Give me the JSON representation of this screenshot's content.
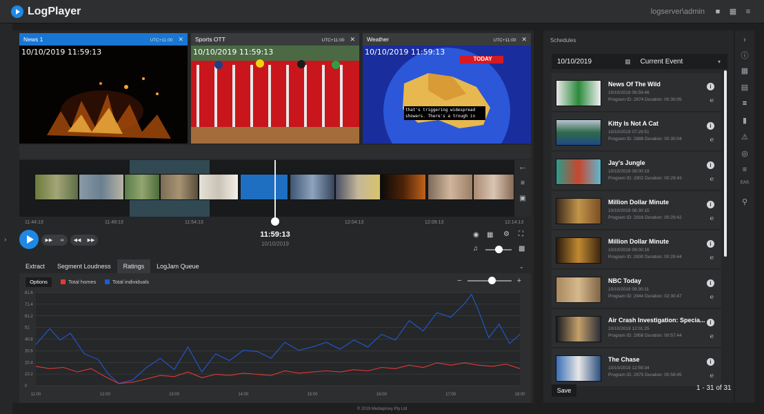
{
  "app": {
    "name": "LogPlayer",
    "user": "logserver\\admin"
  },
  "videos": [
    {
      "name": "News 1",
      "tz": "UTC+11:00",
      "timestamp": "10/10/2019 11:59:13"
    },
    {
      "name": "Sports OTT",
      "tz": "UTC+11:00",
      "timestamp": "10/10/2019 11:59:13"
    },
    {
      "name": "Weather",
      "tz": "UTC+11:00",
      "timestamp": "10/10/2019 11:59:13",
      "badge": "TODAY",
      "caption": "that's triggering widespread showers. There's a trough in"
    }
  ],
  "zoom": {
    "minus": "−",
    "plus": "+"
  },
  "timeline": {
    "ticks": [
      "11:44:13",
      "11:49:13",
      "11:54:13",
      "12:04:13",
      "12:09:13",
      "12:14:13"
    ],
    "current_time": "11:59:13",
    "current_date": "10/10/2019"
  },
  "tabs": [
    {
      "label": "Extract"
    },
    {
      "label": "Segment Loudness"
    },
    {
      "label": "Ratings"
    },
    {
      "label": "LogJam Queue"
    }
  ],
  "ratings": {
    "options_label": "Options",
    "legend": [
      {
        "name": "Total homes",
        "color": "#e53935"
      },
      {
        "name": "Total individuals",
        "color": "#1e5bd6"
      }
    ]
  },
  "chart_data": {
    "type": "line",
    "x_ticks": [
      "11:00",
      "12:00",
      "13:00",
      "14:00",
      "15:00",
      "16:00",
      "17:00",
      "18:00"
    ],
    "y_ticks": [
      "81.6",
      "71.4",
      "61.2",
      "51",
      "40.8",
      "30.6",
      "20.4",
      "10.2",
      "0"
    ],
    "ylim": [
      0,
      81.6
    ],
    "xlim": [
      0,
      7
    ],
    "series": [
      {
        "name": "Total individuals",
        "color": "#1e5bd6",
        "values": [
          [
            0,
            36
          ],
          [
            0.2,
            50
          ],
          [
            0.35,
            40
          ],
          [
            0.5,
            46
          ],
          [
            0.7,
            28
          ],
          [
            0.9,
            23
          ],
          [
            1.05,
            10
          ],
          [
            1.2,
            2
          ],
          [
            1.4,
            5
          ],
          [
            1.6,
            16
          ],
          [
            1.8,
            24
          ],
          [
            2.0,
            14
          ],
          [
            2.2,
            34
          ],
          [
            2.4,
            12
          ],
          [
            2.6,
            28
          ],
          [
            2.8,
            22
          ],
          [
            3.0,
            31
          ],
          [
            3.2,
            30
          ],
          [
            3.4,
            24
          ],
          [
            3.6,
            38
          ],
          [
            3.8,
            31
          ],
          [
            4.0,
            34
          ],
          [
            4.2,
            38
          ],
          [
            4.4,
            32
          ],
          [
            4.6,
            40
          ],
          [
            4.8,
            34
          ],
          [
            5.0,
            45
          ],
          [
            5.2,
            40
          ],
          [
            5.4,
            57
          ],
          [
            5.6,
            48
          ],
          [
            5.8,
            64
          ],
          [
            6.0,
            60
          ],
          [
            6.2,
            72
          ],
          [
            6.3,
            80
          ],
          [
            6.4,
            66
          ],
          [
            6.55,
            42
          ],
          [
            6.7,
            54
          ],
          [
            6.85,
            37
          ],
          [
            7.0,
            45
          ]
        ]
      },
      {
        "name": "Total homes",
        "color": "#e53935",
        "values": [
          [
            0,
            17
          ],
          [
            0.2,
            15
          ],
          [
            0.4,
            16
          ],
          [
            0.6,
            12
          ],
          [
            0.8,
            15
          ],
          [
            1.0,
            8
          ],
          [
            1.2,
            2
          ],
          [
            1.4,
            3
          ],
          [
            1.6,
            6
          ],
          [
            1.8,
            9
          ],
          [
            2.0,
            8
          ],
          [
            2.2,
            12
          ],
          [
            2.4,
            7
          ],
          [
            2.6,
            10
          ],
          [
            2.8,
            9
          ],
          [
            3.0,
            11
          ],
          [
            3.2,
            10
          ],
          [
            3.4,
            9
          ],
          [
            3.6,
            13
          ],
          [
            3.8,
            11
          ],
          [
            4.0,
            12
          ],
          [
            4.2,
            13
          ],
          [
            4.4,
            12
          ],
          [
            4.6,
            14
          ],
          [
            4.8,
            13
          ],
          [
            5.0,
            16
          ],
          [
            5.2,
            15
          ],
          [
            5.4,
            18
          ],
          [
            5.6,
            16
          ],
          [
            5.8,
            20
          ],
          [
            6.0,
            18
          ],
          [
            6.2,
            20
          ],
          [
            6.4,
            18
          ],
          [
            6.6,
            17
          ],
          [
            6.8,
            19
          ],
          [
            7.0,
            15
          ]
        ]
      }
    ]
  },
  "schedules": {
    "title": "Schedules",
    "date": "10/10/2019",
    "mode": "Current Event",
    "items": [
      {
        "title": "News Of The Wild",
        "time": "10/10/2019 06:59:46",
        "meta": "Program ID: 2874   Duration: 00:30:05"
      },
      {
        "title": "Kitty Is Not A Cat",
        "time": "10/10/2019 07:29:51",
        "meta": "Program ID: 2888   Duration: 00:30:04"
      },
      {
        "title": "Jay's Jungle",
        "time": "10/10/2019 08:00:19",
        "meta": "Program ID: 2902   Duration: 00:29:43"
      },
      {
        "title": "Million Dollar Minute",
        "time": "10/10/2019 08:30:15",
        "meta": "Program ID: 2916   Duration: 00:29:42"
      },
      {
        "title": "Million Dollar Minute",
        "time": "10/10/2019 09:00:16",
        "meta": "Program ID: 2930   Duration: 00:29:44"
      },
      {
        "title": "NBC Today",
        "time": "10/10/2019 09:30:11",
        "meta": "Program ID: 2944   Duration: 02:30:47"
      },
      {
        "title": "Air Crash Investigation: Specia...",
        "time": "10/10/2019 12:01:25",
        "meta": "Program ID: 2958   Duration: 00:57:44"
      },
      {
        "title": "The Chase",
        "time": "10/10/2019 12:59:34",
        "meta": "Program ID: 2975   Duration: 00:58:45"
      }
    ],
    "save_label": "Save",
    "count": "1 - 31 of 31"
  },
  "rail": {
    "eas_label": "EAS"
  },
  "footer": "© 2019 Mediaproxy Pty Ltd"
}
